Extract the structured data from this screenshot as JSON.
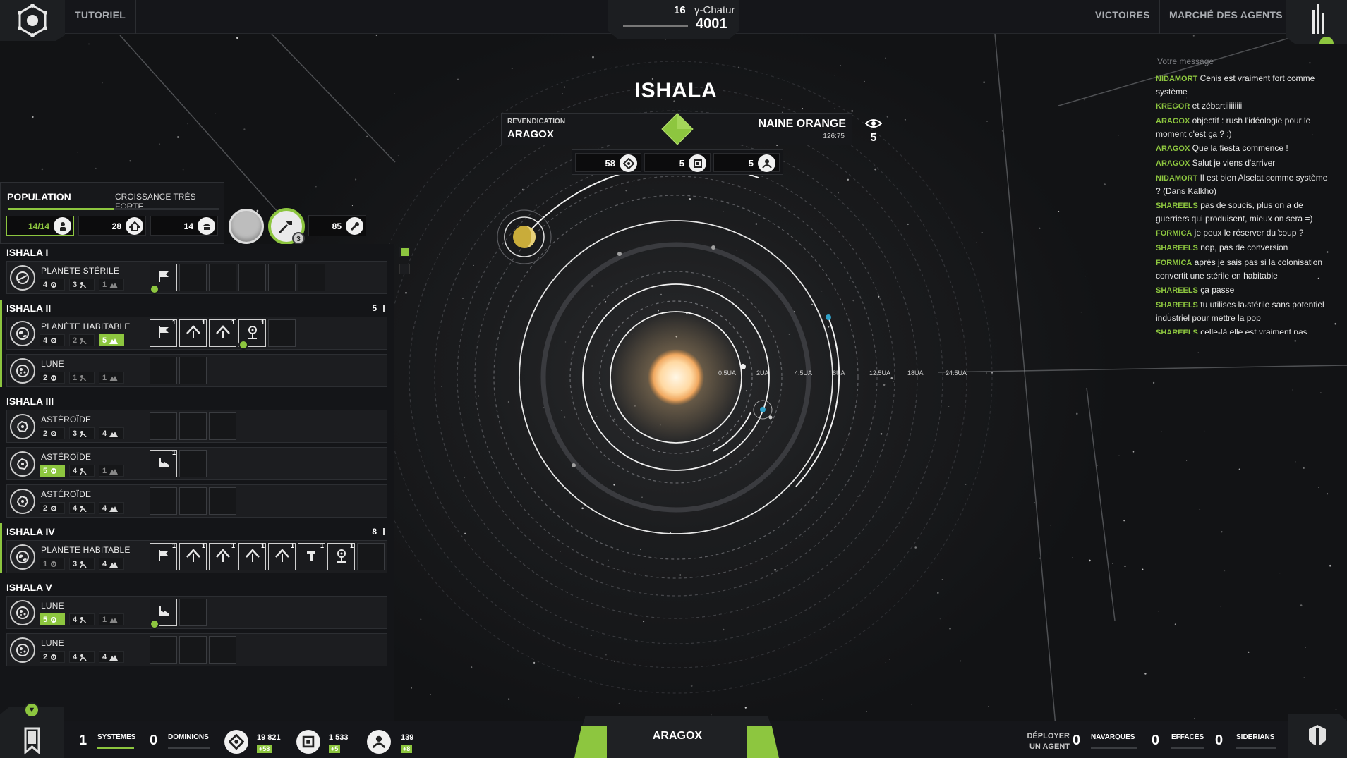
{
  "topbar": {
    "tutorial": "TUTORIEL",
    "turn": "16",
    "system_name": "γ-Chatur",
    "year": "4001",
    "victories": "VICTOIRES",
    "agents_market": "MARCHÉ DES AGENTS"
  },
  "system": {
    "name": "ISHALA",
    "claim_label": "REVENDICATION",
    "claim_owner": "ARAGOX",
    "star_type": "NAINE ORANGE",
    "coords": "126:75",
    "vision": "5",
    "resources": [
      {
        "value": "58",
        "icon": "credits-icon"
      },
      {
        "value": "5",
        "icon": "technology-icon"
      },
      {
        "value": "5",
        "icon": "ideology-icon"
      }
    ],
    "au_labels": [
      "0.5UA",
      "2UA",
      "4.5UA",
      "8UA",
      "12.5UA",
      "18UA",
      "24.5UA"
    ]
  },
  "population": {
    "title": "POPULATION",
    "growth": "CROISSANCE TRÈS FORTE",
    "progress": 0.5,
    "cells": [
      {
        "value": "14/14",
        "icon": "people-icon"
      },
      {
        "value": "28",
        "icon": "housing-icon"
      },
      {
        "value": "14",
        "icon": "soldier-icon"
      }
    ],
    "build_badge": "3",
    "extra": {
      "value": "85",
      "icon": "industry-icon"
    }
  },
  "groups": [
    {
      "name": "ISHALA I",
      "count": "",
      "planets": [
        {
          "type": "PLANÈTE STÉRILE",
          "icon": "barren-planet-icon",
          "stats": [
            {
              "v": "4",
              "hl": false,
              "dim": false
            },
            {
              "v": "3",
              "hl": false,
              "dim": false
            },
            {
              "v": "1",
              "hl": false,
              "dim": true
            }
          ],
          "slots": [
            {
              "filled": true,
              "icon": "flag-icon",
              "lvl": "",
              "gear": true
            },
            {
              "filled": false
            },
            {
              "filled": false
            },
            {
              "filled": false
            },
            {
              "filled": false
            },
            {
              "filled": false
            }
          ]
        }
      ]
    },
    {
      "name": "ISHALA II",
      "count": "5",
      "planets": [
        {
          "type": "PLANÈTE HABITABLE",
          "icon": "habitable-planet-icon",
          "stats": [
            {
              "v": "4",
              "hl": false,
              "dim": false
            },
            {
              "v": "2",
              "hl": false,
              "dim": true
            },
            {
              "v": "5",
              "hl": true,
              "dim": false
            }
          ],
          "slots": [
            {
              "filled": true,
              "icon": "flag-icon",
              "lvl": "1"
            },
            {
              "filled": true,
              "icon": "habitat-icon",
              "lvl": "1"
            },
            {
              "filled": true,
              "icon": "habitat-icon",
              "lvl": "1"
            },
            {
              "filled": true,
              "icon": "lab-icon",
              "lvl": "1",
              "gear": true
            },
            {
              "filled": false
            }
          ]
        },
        {
          "type": "LUNE",
          "icon": "moon-icon",
          "stats": [
            {
              "v": "2",
              "hl": false,
              "dim": false
            },
            {
              "v": "1",
              "hl": false,
              "dim": true
            },
            {
              "v": "1",
              "hl": false,
              "dim": true
            }
          ],
          "slots": [
            {
              "filled": false
            },
            {
              "filled": false
            }
          ]
        }
      ]
    },
    {
      "name": "ISHALA III",
      "count": "",
      "planets": [
        {
          "type": "ASTÉROÏDE",
          "icon": "asteroid-icon",
          "stats": [
            {
              "v": "2",
              "hl": false,
              "dim": false
            },
            {
              "v": "3",
              "hl": false,
              "dim": false
            },
            {
              "v": "4",
              "hl": false,
              "dim": false
            }
          ],
          "slots": [
            {
              "filled": false
            },
            {
              "filled": false
            },
            {
              "filled": false
            }
          ]
        },
        {
          "type": "ASTÉROÏDE",
          "icon": "asteroid-icon",
          "stats": [
            {
              "v": "5",
              "hl": true,
              "dim": false
            },
            {
              "v": "4",
              "hl": false,
              "dim": false
            },
            {
              "v": "1",
              "hl": false,
              "dim": true
            }
          ],
          "slots": [
            {
              "filled": true,
              "icon": "factory-icon",
              "lvl": "1"
            },
            {
              "filled": false
            }
          ]
        },
        {
          "type": "ASTÉROÏDE",
          "icon": "asteroid-icon",
          "stats": [
            {
              "v": "2",
              "hl": false,
              "dim": false
            },
            {
              "v": "4",
              "hl": false,
              "dim": false
            },
            {
              "v": "4",
              "hl": false,
              "dim": false
            }
          ],
          "slots": [
            {
              "filled": false
            },
            {
              "filled": false
            },
            {
              "filled": false
            }
          ]
        }
      ]
    },
    {
      "name": "ISHALA IV",
      "count": "8",
      "planets": [
        {
          "type": "PLANÈTE HABITABLE",
          "icon": "habitable-planet-icon",
          "stats": [
            {
              "v": "1",
              "hl": false,
              "dim": true
            },
            {
              "v": "3",
              "hl": false,
              "dim": false
            },
            {
              "v": "4",
              "hl": false,
              "dim": false
            }
          ],
          "slots": [
            {
              "filled": true,
              "icon": "flag-icon",
              "lvl": "1"
            },
            {
              "filled": true,
              "icon": "habitat-icon",
              "lvl": "1"
            },
            {
              "filled": true,
              "icon": "habitat-icon",
              "lvl": "1"
            },
            {
              "filled": true,
              "icon": "habitat-icon",
              "lvl": "1"
            },
            {
              "filled": true,
              "icon": "habitat-icon",
              "lvl": "1"
            },
            {
              "filled": true,
              "icon": "hammer-icon",
              "lvl": "1"
            },
            {
              "filled": true,
              "icon": "lab-icon",
              "lvl": "1"
            },
            {
              "filled": false
            }
          ]
        }
      ]
    },
    {
      "name": "ISHALA V",
      "count": "",
      "planets": [
        {
          "type": "LUNE",
          "icon": "moon-icon",
          "stats": [
            {
              "v": "5",
              "hl": true,
              "dim": false
            },
            {
              "v": "4",
              "hl": false,
              "dim": false
            },
            {
              "v": "1",
              "hl": false,
              "dim": true
            }
          ],
          "slots": [
            {
              "filled": true,
              "icon": "factory-icon",
              "lvl": "",
              "gear": true
            },
            {
              "filled": false
            }
          ]
        },
        {
          "type": "LUNE",
          "icon": "moon-icon",
          "stats": [
            {
              "v": "2",
              "hl": false,
              "dim": false
            },
            {
              "v": "4",
              "hl": false,
              "dim": false
            },
            {
              "v": "4",
              "hl": false,
              "dim": false
            }
          ],
          "slots": [
            {
              "filled": false
            },
            {
              "filled": false
            },
            {
              "filled": false
            }
          ]
        }
      ]
    }
  ],
  "chat": {
    "placeholder": "Votre message",
    "messages": [
      {
        "who": "NIDAMORT",
        "text": "Cenis est vraiment fort comme système"
      },
      {
        "who": "KREGOR",
        "text": "et zébartiiiiiiiii"
      },
      {
        "who": "ARAGOX",
        "text": "objectif : rush l'idéologie pour le moment c'est ça ? :)"
      },
      {
        "who": "ARAGOX",
        "text": "Que la fiesta commence !"
      },
      {
        "who": "ARAGOX",
        "text": "Salut je viens d'arriver"
      },
      {
        "who": "NIDAMORT",
        "text": "Il est bien Alselat comme système ? (Dans Kalkho)"
      },
      {
        "who": "SHAREELS",
        "text": "pas de soucis, plus on a de guerriers qui produisent, mieux on sera =)"
      },
      {
        "who": "FORMICA",
        "text": "je peux le réserver du coup ?"
      },
      {
        "who": "SHAREELS",
        "text": "nop, pas de conversion"
      },
      {
        "who": "FORMICA",
        "text": "après je sais pas si la colonisation convertit une stérile en habitable"
      },
      {
        "who": "SHAREELS",
        "text": "ça passe"
      },
      {
        "who": "SHAREELS",
        "text": "tu utilises la stérile sans potentiel industriel pour mettre la pop"
      },
      {
        "who": "SHAREELS",
        "text": "celle-là elle est vraiment pas"
      }
    ]
  },
  "bottombar": {
    "systems_count": "1",
    "systems_label": "SYSTÈMES",
    "dominions_count": "0",
    "dominions_label": "DOMINIONS",
    "resources": [
      {
        "value": "19 821",
        "delta": "+58",
        "icon": "credits-icon"
      },
      {
        "value": "1 533",
        "delta": "+5",
        "icon": "technology-icon"
      },
      {
        "value": "139",
        "delta": "+8",
        "icon": "ideology-icon"
      }
    ],
    "player": "ARAGOX",
    "deploy_line1": "DÉPLOYER",
    "deploy_line2": "UN AGENT",
    "agents": [
      {
        "count": "0",
        "label": "NAVARQUES"
      },
      {
        "count": "0",
        "label": "EFFACÉS"
      },
      {
        "count": "0",
        "label": "SIDERIANS"
      }
    ]
  },
  "colors": {
    "accent": "#8dc63f",
    "panel": "#17181b",
    "background": "#121315"
  }
}
